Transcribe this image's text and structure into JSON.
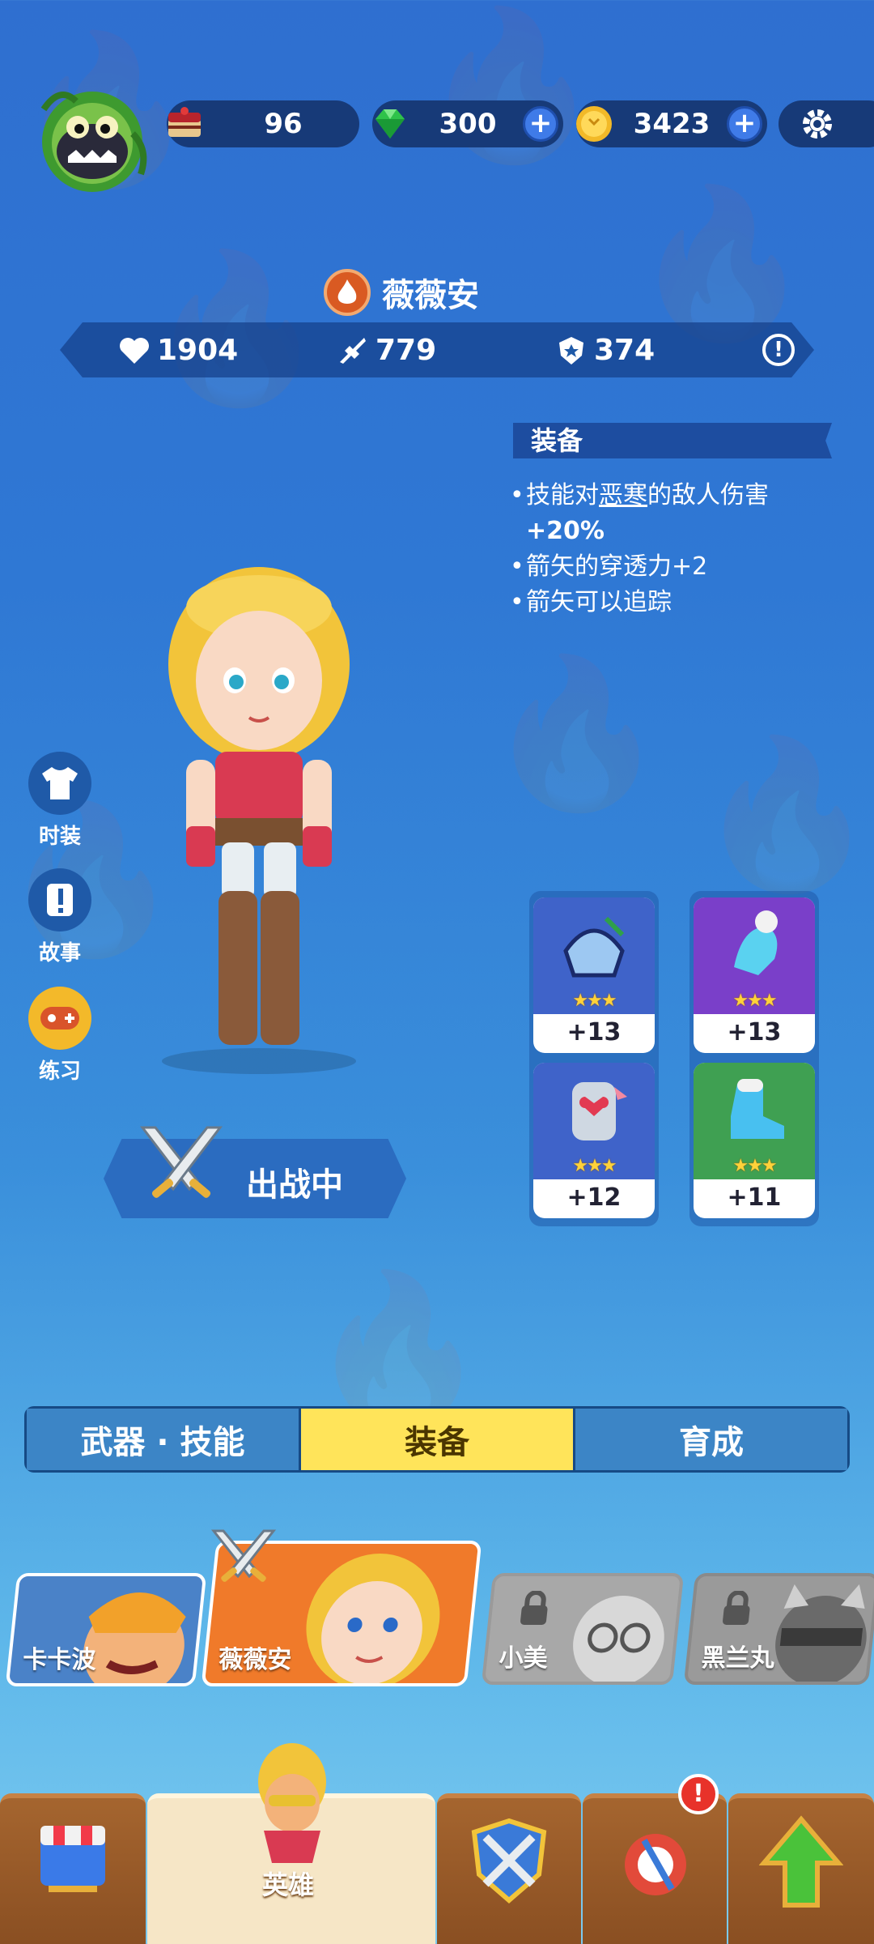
{
  "resources": {
    "cake": {
      "value": "96",
      "icon": "cake-icon"
    },
    "gems": {
      "value": "300",
      "icon": "green-gem-icon"
    },
    "coins": {
      "value": "3423",
      "icon": "gold-coin-icon"
    }
  },
  "hero": {
    "name": "薇薇安",
    "element_icon": "flame-icon",
    "stats": {
      "hp": "1904",
      "attack": "779",
      "defense": "374"
    }
  },
  "equipment_panel": {
    "title": "装备",
    "line1_pre": "技能对",
    "line1_highlight": "恶寒",
    "line1_post": "的敌人伤害",
    "line1_cont": "+20%",
    "line2": "箭矢的穿透力+2",
    "line3": "箭矢可以追踪"
  },
  "side_menu": {
    "fashion": "时装",
    "story": "故事",
    "practice": "练习"
  },
  "equipment": [
    {
      "name": "helmet",
      "level": "+13",
      "stars": "★★★",
      "color": "#3f63c9"
    },
    {
      "name": "glove",
      "level": "+13",
      "stars": "★★★",
      "color": "#7a3fc9"
    },
    {
      "name": "armor",
      "level": "+12",
      "stars": "★★★",
      "color": "#3f63c9"
    },
    {
      "name": "boots",
      "level": "+11",
      "stars": "★★★",
      "color": "#3fa052"
    }
  ],
  "deploy_button": "出战中",
  "tabs": [
    {
      "label": "武器 · 技能",
      "active": false
    },
    {
      "label": "装备",
      "active": true
    },
    {
      "label": "育成",
      "active": false
    }
  ],
  "heroes": [
    {
      "name": "卡卡波",
      "locked": false,
      "selected": false
    },
    {
      "name": "薇薇安",
      "locked": false,
      "selected": true
    },
    {
      "name": "小美",
      "locked": true,
      "selected": false
    },
    {
      "name": "黑兰丸",
      "locked": true,
      "selected": false
    }
  ],
  "bottom_nav": {
    "shop": "",
    "hero": "英雄",
    "battle": "",
    "pets": "",
    "upgrade": ""
  }
}
